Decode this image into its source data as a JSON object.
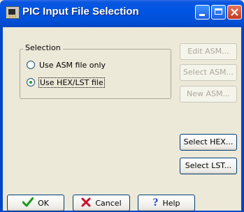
{
  "window": {
    "title": "PIC Input File Selection"
  },
  "selection": {
    "group_label": "Selection",
    "option1": "Use ASM file only",
    "option2": "Use HEX/LST file",
    "selected": "option2"
  },
  "buttons": {
    "edit_asm": "Edit ASM...",
    "select_asm": "Select ASM...",
    "new_asm": "New ASM...",
    "select_hex": "Select HEX...",
    "select_lst": "Select LST..."
  },
  "footer": {
    "ok": "OK",
    "cancel": "Cancel",
    "help": "Help"
  },
  "icons": {
    "ok": "green-check-icon",
    "cancel": "red-x-icon",
    "help": "blue-question-icon"
  }
}
